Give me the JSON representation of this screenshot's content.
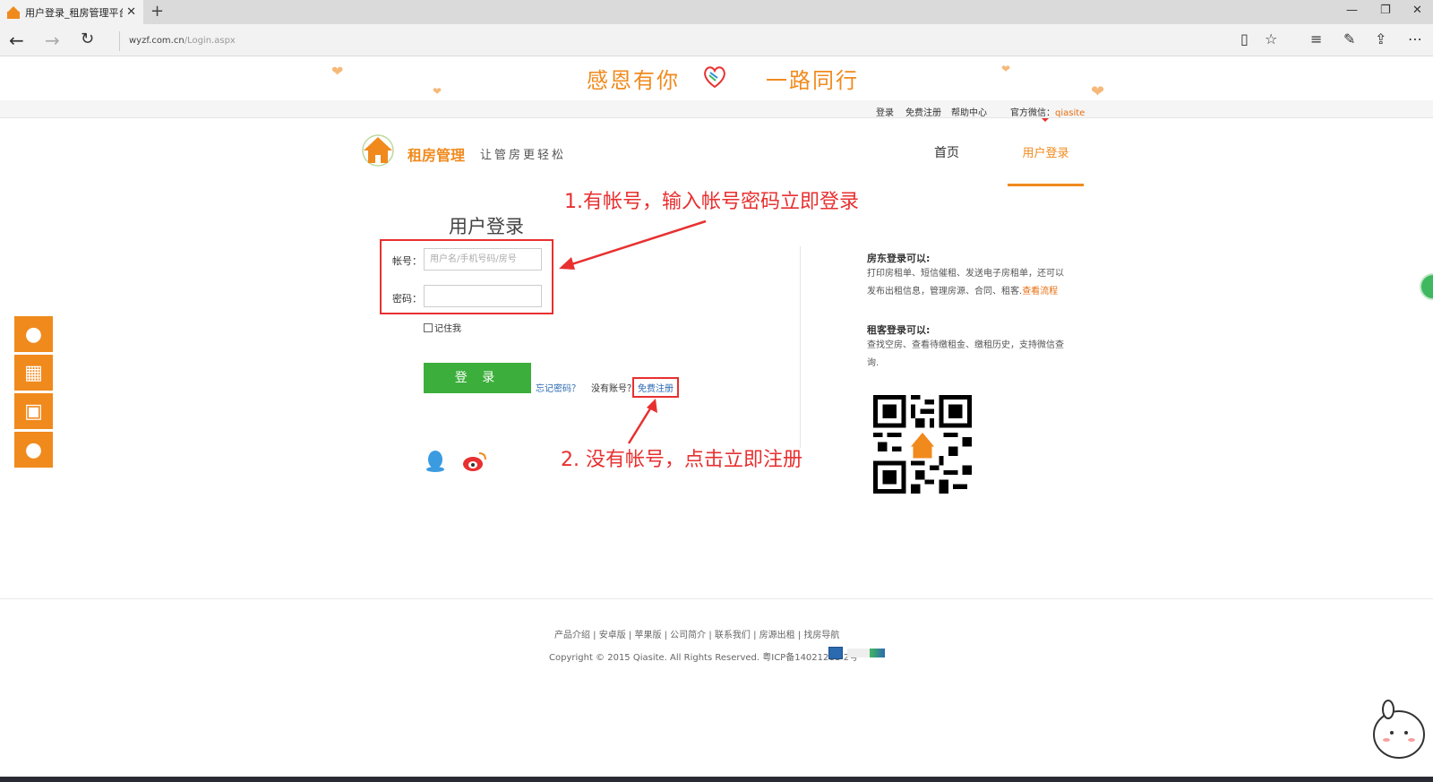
{
  "browser": {
    "tab_title": "用户登录_租房管理平台",
    "new_tab": "+",
    "url_host": "wyzf.com.cn",
    "url_path": "/Login.aspx"
  },
  "banner": {
    "left_text": "感恩有你",
    "right_text": "一路同行"
  },
  "top_links": {
    "login": "登录",
    "register": "免费注册",
    "help": "帮助中心",
    "wechat_label": "官方微信：",
    "wechat_id": "qiasite"
  },
  "header": {
    "logo_title": "租房管理",
    "slogan": "让管房更轻松",
    "nav_home": "首页",
    "nav_login": "用户登录"
  },
  "annotations": {
    "step1": "1.有帐号，输入帐号密码立即登录",
    "step2": "2. 没有帐号，点击立即注册"
  },
  "login": {
    "title": "用户登录",
    "account_label": "帐号：",
    "account_placeholder": "用户名/手机号码/房号",
    "password_label": "密码：",
    "remember": "记住我",
    "login_button": "登 录",
    "forgot": "忘记密码？",
    "no_account": "没有账号？",
    "register": "免费注册"
  },
  "info": {
    "landlord_title": "房东登录可以:",
    "landlord_text": "打印房租单、短信催租、发送电子房租单，还可以发布出租信息，管理房源、合同、租客.",
    "landlord_link": "查看流程",
    "tenant_title": "租客登录可以:",
    "tenant_text": "查找空房、查看待缴租金、缴租历史，支持微信查询."
  },
  "footer": {
    "links": "产品介绍 | 安卓版 | 苹果版 | 公司简介 | 联系我们 | 房源出租 | 找房导航",
    "copyright": "Copyright © 2015 Qiasite. All Rights Reserved. 粤ICP备14021211-2号"
  },
  "colors": {
    "brand_orange": "#f08a1d",
    "annotation_red": "#e83030",
    "login_green": "#3cae3c",
    "link_blue": "#2b6ab0"
  }
}
